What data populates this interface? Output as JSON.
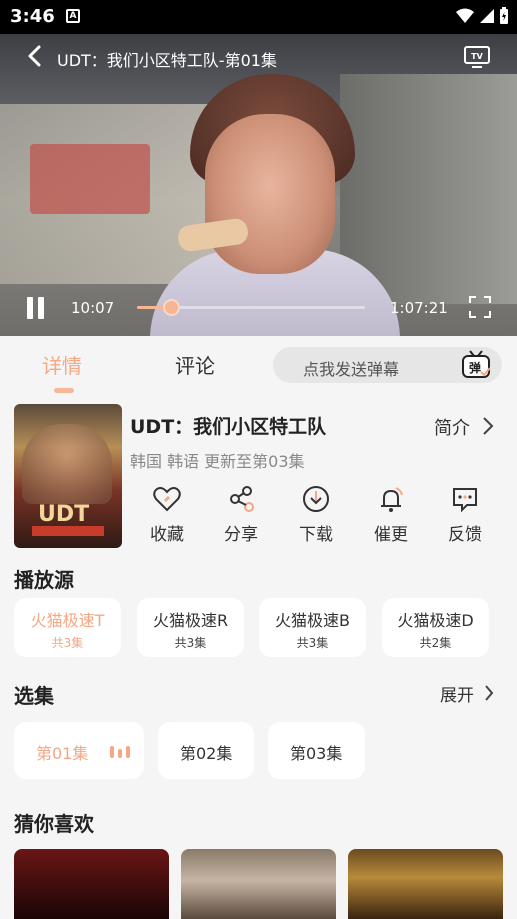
{
  "status": {
    "time": "3:46",
    "notif_icon": "A"
  },
  "player": {
    "title": "UDT：我们小区特工队-第01集",
    "current_time": "10:07",
    "total_time": "1:07:21",
    "progress": 0.15
  },
  "tabs": {
    "detail": "详情",
    "comment": "评论"
  },
  "danmu": {
    "placeholder": "点我发送弹幕",
    "icon_text": "弹"
  },
  "show": {
    "title": "UDT：我们小区特工队",
    "intro_label": "简介",
    "meta": "韩国 韩语 更新至第03集",
    "poster_text": "UDT"
  },
  "actions": [
    {
      "label": "收藏",
      "icon": "heart-icon"
    },
    {
      "label": "分享",
      "icon": "share-icon"
    },
    {
      "label": "下载",
      "icon": "download-icon"
    },
    {
      "label": "催更",
      "icon": "bell-icon"
    },
    {
      "label": "反馈",
      "icon": "feedback-icon"
    }
  ],
  "sources_section": {
    "title": "播放源",
    "items": [
      {
        "name": "火猫极速T",
        "count": "共3集",
        "active": true
      },
      {
        "name": "火猫极速R",
        "count": "共3集",
        "active": false
      },
      {
        "name": "火猫极速B",
        "count": "共3集",
        "active": false
      },
      {
        "name": "火猫极速D",
        "count": "共2集",
        "active": false
      }
    ]
  },
  "episodes_section": {
    "title": "选集",
    "expand_label": "展开",
    "items": [
      {
        "label": "第01集",
        "active": true
      },
      {
        "label": "第02集",
        "active": false
      },
      {
        "label": "第03集",
        "active": false
      }
    ]
  },
  "recommend_section": {
    "title": "猜你喜欢"
  },
  "colors": {
    "accent": "#f5a785",
    "background": "#f5f5f5"
  }
}
